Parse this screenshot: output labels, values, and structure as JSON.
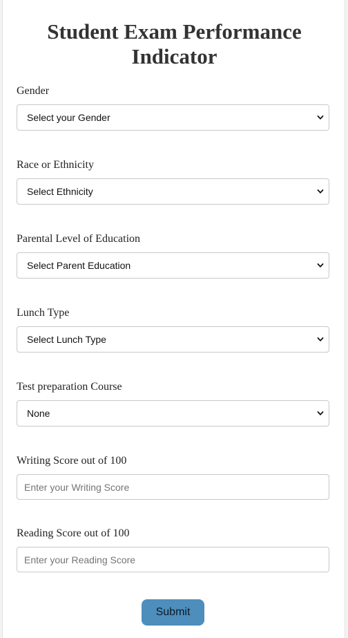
{
  "page": {
    "title": "Student Exam Performance Indicator"
  },
  "form": {
    "gender": {
      "label": "Gender",
      "selected": "Select your Gender"
    },
    "ethnicity": {
      "label": "Race or Ethnicity",
      "selected": "Select Ethnicity"
    },
    "parental_education": {
      "label": "Parental Level of Education",
      "selected": "Select Parent Education"
    },
    "lunch": {
      "label": "Lunch Type",
      "selected": "Select Lunch Type"
    },
    "test_prep": {
      "label": "Test preparation Course",
      "selected": "None"
    },
    "writing_score": {
      "label": "Writing Score out of 100",
      "placeholder": "Enter your Writing Score"
    },
    "reading_score": {
      "label": "Reading Score out of 100",
      "placeholder": "Enter your Reading Score"
    },
    "submit_label": "Submit"
  },
  "colors": {
    "button": "#4d8ebd",
    "title_text": "#333333"
  },
  "icons": {
    "select_arrow": "chevron-down-icon"
  }
}
